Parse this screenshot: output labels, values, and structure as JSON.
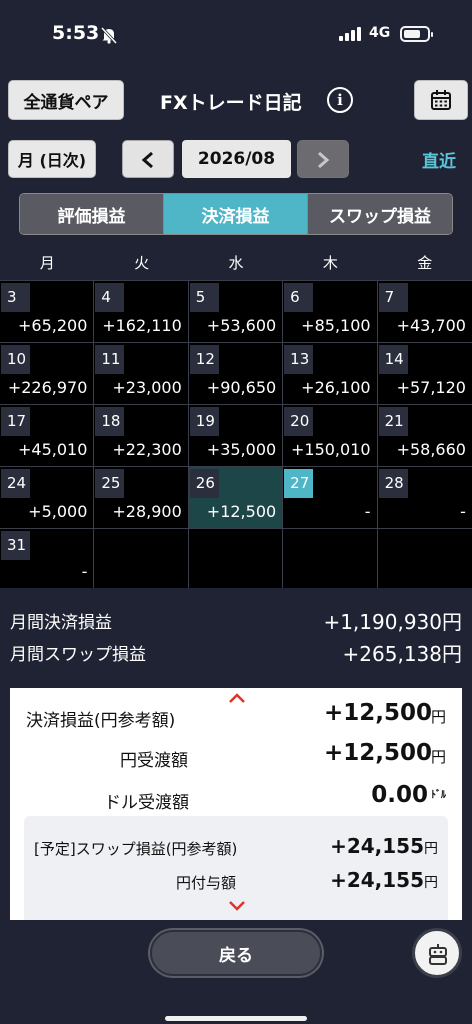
{
  "status_bar": {
    "time": "5:53",
    "network": "4G"
  },
  "header": {
    "all_pairs_label": "全通貨ペア",
    "title": "FXトレード日記",
    "info_icon": "i"
  },
  "period": {
    "mode_label": "月 (日次)",
    "month": "2026/08",
    "recent_label": "直近"
  },
  "segments": [
    {
      "label": "評価損益",
      "active": false
    },
    {
      "label": "決済損益",
      "active": true
    },
    {
      "label": "スワップ損益",
      "active": false
    }
  ],
  "calendar": {
    "weekdays": [
      "月",
      "火",
      "水",
      "木",
      "金"
    ],
    "weeks": [
      [
        {
          "day": "3",
          "value": "+65,200"
        },
        {
          "day": "4",
          "value": "+162,110"
        },
        {
          "day": "5",
          "value": "+53,600"
        },
        {
          "day": "6",
          "value": "+85,100"
        },
        {
          "day": "7",
          "value": "+43,700"
        }
      ],
      [
        {
          "day": "10",
          "value": "+226,970"
        },
        {
          "day": "11",
          "value": "+23,000"
        },
        {
          "day": "12",
          "value": "+90,650"
        },
        {
          "day": "13",
          "value": "+26,100"
        },
        {
          "day": "14",
          "value": "+57,120"
        }
      ],
      [
        {
          "day": "17",
          "value": "+45,010"
        },
        {
          "day": "18",
          "value": "+22,300"
        },
        {
          "day": "19",
          "value": "+35,000"
        },
        {
          "day": "20",
          "value": "+150,010"
        },
        {
          "day": "21",
          "value": "+58,660"
        }
      ],
      [
        {
          "day": "24",
          "value": "+5,000"
        },
        {
          "day": "25",
          "value": "+28,900"
        },
        {
          "day": "26",
          "value": "+12,500",
          "selected": true
        },
        {
          "day": "27",
          "value": "-",
          "today": true
        },
        {
          "day": "28",
          "value": "-"
        }
      ],
      [
        {
          "day": "31",
          "value": "-"
        },
        {
          "day": "",
          "value": ""
        },
        {
          "day": "",
          "value": ""
        },
        {
          "day": "",
          "value": ""
        },
        {
          "day": "",
          "value": ""
        }
      ]
    ]
  },
  "summary": {
    "monthly_settled_label": "月間決済損益",
    "monthly_settled_value": "+1,190,930円",
    "monthly_swap_label": "月間スワップ損益",
    "monthly_swap_value": "+265,138円"
  },
  "detail": {
    "settled_label": "決済損益(円参考額)",
    "settled_value": "+12,500",
    "settled_unit": "円",
    "yen_transfer_label": "円受渡額",
    "yen_transfer_value": "+12,500",
    "yen_transfer_unit": "円",
    "usd_transfer_label": "ドル受渡額",
    "usd_transfer_value": "0.00",
    "usd_transfer_unit": "ﾄﾞﾙ",
    "sched_swap_label": "[予定]スワップ損益(円参考額)",
    "sched_swap_value": "+24,155",
    "sched_swap_unit": "円",
    "yen_grant_label": "円付与額",
    "yen_grant_value": "+24,155",
    "yen_grant_unit": "円"
  },
  "footer": {
    "back_label": "戻る"
  }
}
